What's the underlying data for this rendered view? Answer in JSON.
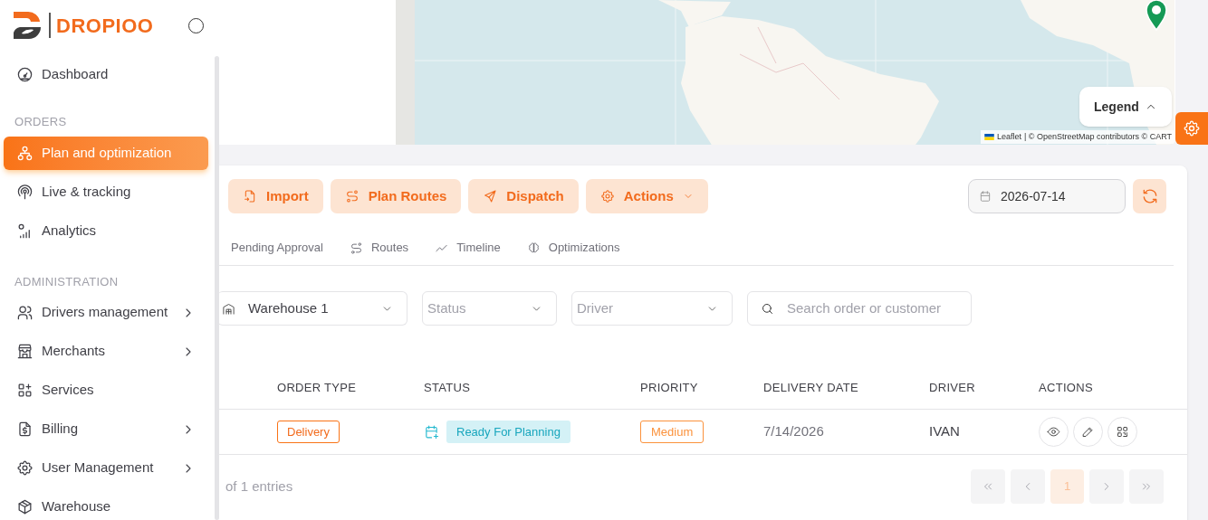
{
  "sidebar": {
    "brand": "DROPIOO",
    "sections": [
      {
        "items": [
          {
            "label": "Dashboard",
            "kind": "link",
            "selected": false
          }
        ]
      },
      {
        "heading": "ORDERS",
        "items": [
          {
            "label": "Plan and optimization",
            "kind": "link",
            "selected": true
          },
          {
            "label": "Live & tracking",
            "kind": "link",
            "selected": false
          },
          {
            "label": "Analytics",
            "kind": "link",
            "selected": false
          }
        ]
      },
      {
        "heading": "ADMINISTRATION",
        "items": [
          {
            "label": "Drivers management",
            "kind": "submenu",
            "selected": false
          },
          {
            "label": "Merchants",
            "kind": "submenu",
            "selected": false
          },
          {
            "label": "Services",
            "kind": "link",
            "selected": false
          },
          {
            "label": "Billing",
            "kind": "submenu",
            "selected": false
          },
          {
            "label": "User Management",
            "kind": "submenu",
            "selected": false
          },
          {
            "label": "Warehouse",
            "kind": "link",
            "selected": false
          }
        ]
      }
    ]
  },
  "map": {
    "legend_button": "Legend",
    "attribution_link": "Leaflet",
    "attribution": "| © OpenStreetMap contributors © CART"
  },
  "toolbar": {
    "buttons": [
      {
        "label": "Import",
        "dropdown": false
      },
      {
        "label": "Plan Routes",
        "dropdown": false
      },
      {
        "label": "Dispatch",
        "dropdown": false
      },
      {
        "label": "Actions",
        "dropdown": true
      }
    ],
    "date_field": {
      "value": "2026-07-14"
    }
  },
  "tabs": [
    {
      "label": "Pending Approval",
      "selected": false
    },
    {
      "label": "Routes",
      "selected": false
    },
    {
      "label": "Timeline",
      "selected": false
    },
    {
      "label": "Optimizations",
      "selected": false
    }
  ],
  "filters": [
    {
      "kind": "select",
      "value": "Warehouse 1"
    },
    {
      "kind": "select",
      "placeholder": "Status"
    },
    {
      "kind": "select",
      "placeholder": "Driver"
    },
    {
      "kind": "search",
      "placeholder": "Search order or customer"
    }
  ],
  "table": {
    "columns": [
      "ORDER TYPE",
      "STATUS",
      "PRIORITY",
      "DELIVERY DATE",
      "DRIVER",
      "ACTIONS"
    ],
    "rows": [
      {
        "order_type": "Delivery",
        "status": "Ready For Planning",
        "priority": "Medium",
        "delivery_date": "7/14/2026",
        "driver": "IVAN"
      }
    ]
  },
  "footer": {
    "entries": "of 1 entries",
    "pages": [
      {
        "label": "1",
        "selected": true
      }
    ]
  }
}
